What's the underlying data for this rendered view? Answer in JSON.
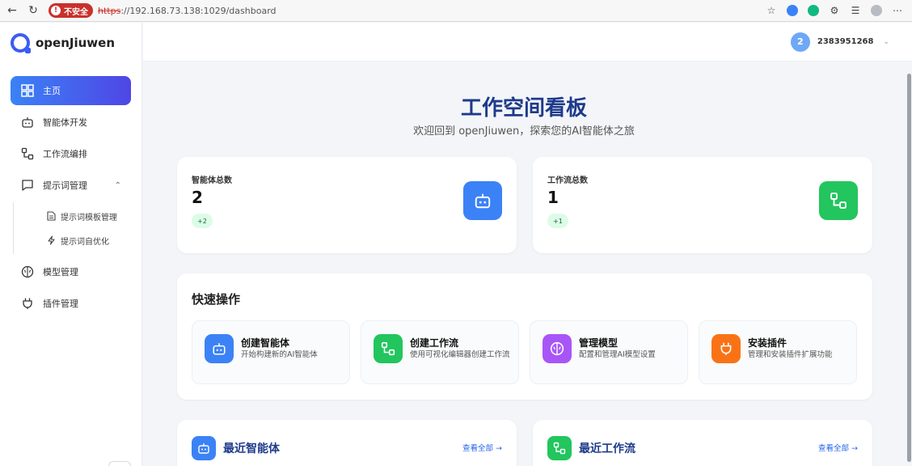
{
  "browser": {
    "security_label": "不安全",
    "url_scheme": "https",
    "url_rest": "://192.168.73.138:1029/dashboard"
  },
  "app": {
    "name": "openJiuwen"
  },
  "sidebar": {
    "items": [
      {
        "label": "主页",
        "icon": "grid-icon",
        "active": true
      },
      {
        "label": "智能体开发",
        "icon": "robot-icon"
      },
      {
        "label": "工作流编排",
        "icon": "workflow-icon"
      },
      {
        "label": "提示词管理",
        "icon": "chat-icon",
        "expanded": true
      },
      {
        "label": "模型管理",
        "icon": "brain-icon"
      },
      {
        "label": "插件管理",
        "icon": "plug-icon"
      }
    ],
    "sub_items": [
      {
        "label": "提示词模板管理",
        "icon": "document-icon"
      },
      {
        "label": "提示词自优化",
        "icon": "lightning-icon"
      }
    ]
  },
  "header": {
    "avatar_text": "2",
    "username": "2383951268"
  },
  "hero": {
    "title": "工作空间看板",
    "subtitle": "欢迎回到 openJiuwen，探索您的AI智能体之旅"
  },
  "stats": [
    {
      "label": "智能体总数",
      "value": "2",
      "delta": "+2",
      "icon": "robot-icon",
      "color": "#3b82f6"
    },
    {
      "label": "工作流总数",
      "value": "1",
      "delta": "+1",
      "icon": "workflow-icon",
      "color": "#22c55e"
    }
  ],
  "quick_actions": {
    "title": "快速操作",
    "items": [
      {
        "name": "创建智能体",
        "desc": "开始构建新的AI智能体",
        "icon": "robot-icon",
        "color": "#3b82f6"
      },
      {
        "name": "创建工作流",
        "desc": "使用可视化编辑器创建工作流",
        "icon": "workflow-icon",
        "color": "#22c55e"
      },
      {
        "name": "管理模型",
        "desc": "配置和管理AI模型设置",
        "icon": "brain-icon",
        "color": "#a855f7"
      },
      {
        "name": "安装插件",
        "desc": "管理和安装插件扩展功能",
        "icon": "plug-icon",
        "color": "#f97316"
      }
    ]
  },
  "recent": [
    {
      "title": "最近智能体",
      "link": "查看全部 →",
      "icon": "robot-icon",
      "color": "#3b82f6"
    },
    {
      "title": "最近工作流",
      "link": "查看全部 →",
      "icon": "workflow-icon",
      "color": "#22c55e"
    }
  ]
}
